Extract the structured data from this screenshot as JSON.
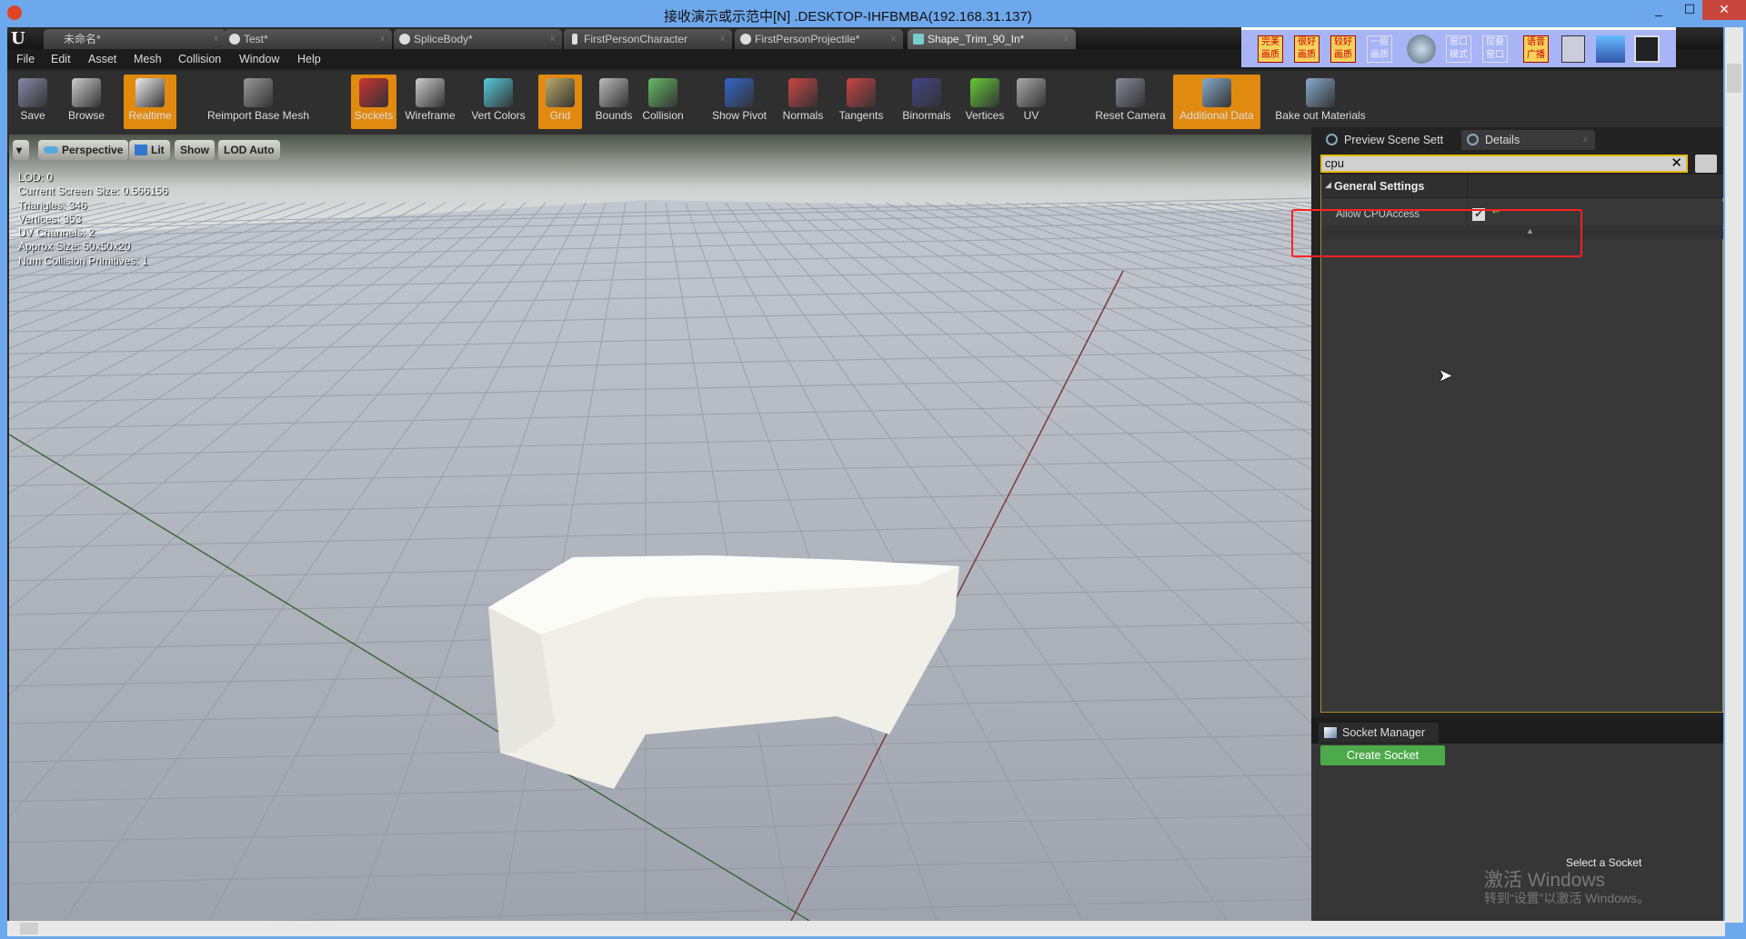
{
  "window": {
    "title": "接收演示或示范中[N] .DESKTOP-IHFBMBA(192.168.31.137)",
    "minimize": "_",
    "maximize": "☐",
    "close": "✕"
  },
  "tabs": [
    {
      "label": "未命名*"
    },
    {
      "label": "Test*"
    },
    {
      "label": "SpliceBody*"
    },
    {
      "label": "FirstPersonCharacter"
    },
    {
      "label": "FirstPersonProjectile*"
    },
    {
      "label": "Shape_Trim_90_In*",
      "active": true
    }
  ],
  "menu": [
    "File",
    "Edit",
    "Asset",
    "Mesh",
    "Collision",
    "Window",
    "Help"
  ],
  "toolbar": [
    {
      "label": "Save",
      "icon": "save-icon"
    },
    {
      "label": "Browse",
      "icon": "browse-icon"
    },
    {
      "label": "Realtime",
      "icon": "realtime-icon",
      "active": true
    },
    {
      "label": "Reimport Base Mesh",
      "icon": "reimport-icon"
    },
    {
      "label": "Sockets",
      "icon": "sockets-icon",
      "active": true
    },
    {
      "label": "Wireframe",
      "icon": "wireframe-icon"
    },
    {
      "label": "Vert Colors",
      "icon": "vert-colors-icon"
    },
    {
      "label": "Grid",
      "icon": "grid-icon",
      "active": true
    },
    {
      "label": "Bounds",
      "icon": "bounds-icon"
    },
    {
      "label": "Collision",
      "icon": "collision-icon"
    },
    {
      "label": "Show Pivot",
      "icon": "pivot-icon"
    },
    {
      "label": "Normals",
      "icon": "normals-icon"
    },
    {
      "label": "Tangents",
      "icon": "tangents-icon"
    },
    {
      "label": "Binormals",
      "icon": "binormals-icon"
    },
    {
      "label": "Vertices",
      "icon": "vertices-icon"
    },
    {
      "label": "UV",
      "icon": "uv-icon"
    },
    {
      "label": "Reset Camera",
      "icon": "camera-icon"
    },
    {
      "label": "Additional Data",
      "icon": "additional-data-icon",
      "active": true
    },
    {
      "label": "Bake out Materials",
      "icon": "bake-icon"
    }
  ],
  "remote_toolbar": [
    "完美画质",
    "很好画质",
    "较好画质",
    "一般画质",
    "窗口模式",
    "层叠窗口",
    "语音广播"
  ],
  "viewport": {
    "options": "▾",
    "perspective": "Perspective",
    "lit": "Lit",
    "show": "Show",
    "lod": "LOD Auto",
    "stats": [
      "LOD:  0",
      "Current Screen Size:  0.566156",
      "Triangles:  346",
      "Vertices:  353",
      "UV Channels:  2",
      "Approx Size: 50x50x20",
      "Num Collision Primitives:  1"
    ]
  },
  "details": {
    "tab_preview": "Preview Scene Sett",
    "tab_details": "Details",
    "search_value": "cpu",
    "clear": "✕",
    "category": "General Settings",
    "property": "Allow CPUAccess",
    "checked": true
  },
  "socket": {
    "tab": "Socket Manager",
    "create": "Create Socket",
    "empty": "Select a Socket"
  },
  "watermark": {
    "line1": "激活 Windows",
    "line2": "转到“设置”以激活 Windows。"
  },
  "colors": {
    "accent": "#e08a10",
    "highlight": "#ff2020",
    "create": "#4daa4a"
  }
}
